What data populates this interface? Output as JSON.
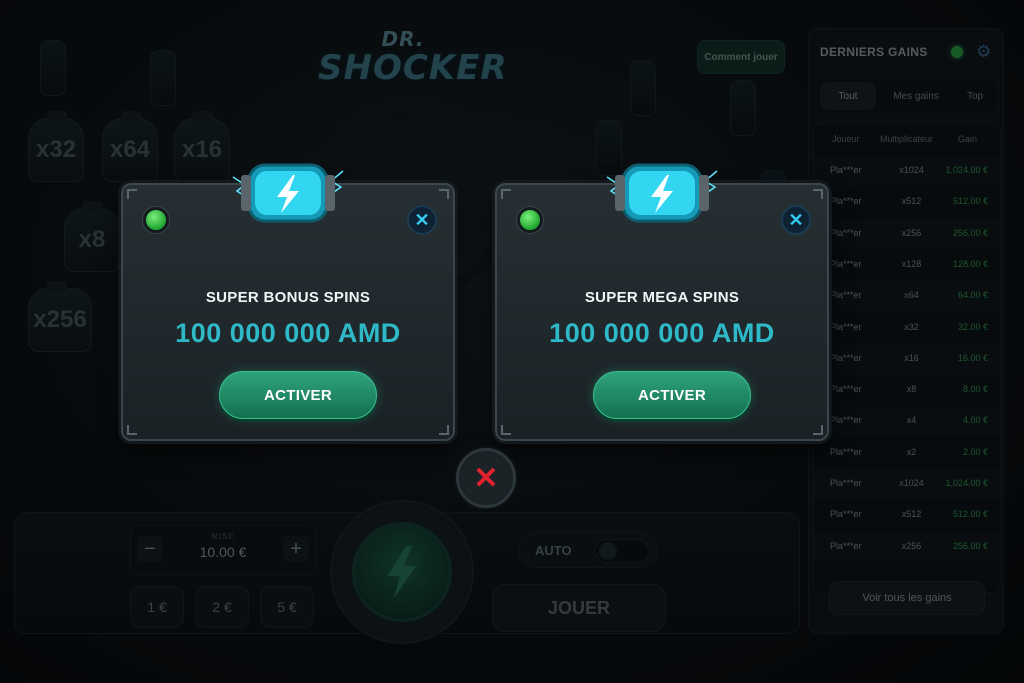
{
  "game": {
    "logo_line1": "DR.",
    "logo_line2": "SHOCKER",
    "how_to_play": "Comment jouer"
  },
  "background_multipliers": [
    "x32",
    "x64",
    "x16",
    "x8",
    "x256"
  ],
  "controls": {
    "bet_label": "MISE",
    "bet_value": "10.00 €",
    "minus": "−",
    "plus": "+",
    "quick_bets": [
      "1 €",
      "2 €",
      "5 €"
    ],
    "auto_label": "AUTO",
    "play_label": "JOUER"
  },
  "sidebar": {
    "title": "DERNIERS GAINS",
    "tabs": [
      "Tout",
      "Mes gains",
      "Top"
    ],
    "active_tab": "Tout",
    "columns": [
      "Joueur",
      "Multiplicateur",
      "Gain"
    ],
    "rows": [
      [
        "Pla***er",
        "x1024",
        "1,024.00 €"
      ],
      [
        "Pla***er",
        "x512",
        "512.00 €"
      ],
      [
        "Pla***er",
        "x256",
        "256.00 €"
      ],
      [
        "Pla***er",
        "x128",
        "128.00 €"
      ],
      [
        "Pla***er",
        "x64",
        "64.00 €"
      ],
      [
        "Pla***er",
        "x32",
        "32.00 €"
      ],
      [
        "Pla***er",
        "x16",
        "16.00 €"
      ],
      [
        "Pla***er",
        "x8",
        "8.00 €"
      ],
      [
        "Pla***er",
        "x4",
        "4.00 €"
      ],
      [
        "Pla***er",
        "x2",
        "2.00 €"
      ],
      [
        "Pla***er",
        "x1024",
        "1,024.00 €"
      ],
      [
        "Pla***er",
        "x512",
        "512.00 €"
      ],
      [
        "Pla***er",
        "x256",
        "256.00 €"
      ]
    ],
    "see_all": "Voir tous les gains"
  },
  "popups": [
    {
      "name": "SUPER BONUS SPINS",
      "amount": "100 000 000 AMD",
      "button": "ACTIVER"
    },
    {
      "name": "SUPER MEGA SPINS",
      "amount": "100 000 000 AMD",
      "button": "ACTIVER"
    }
  ],
  "icons": {
    "close": "close-icon",
    "status": "green-status-icon",
    "energy": "lightning-battery-icon",
    "settings": "gear-icon"
  },
  "colors": {
    "accent_cyan": "#2fb9c8",
    "button_green": "#1f8a64",
    "gain_green": "#3fb65c",
    "close_red": "#e2222e"
  }
}
